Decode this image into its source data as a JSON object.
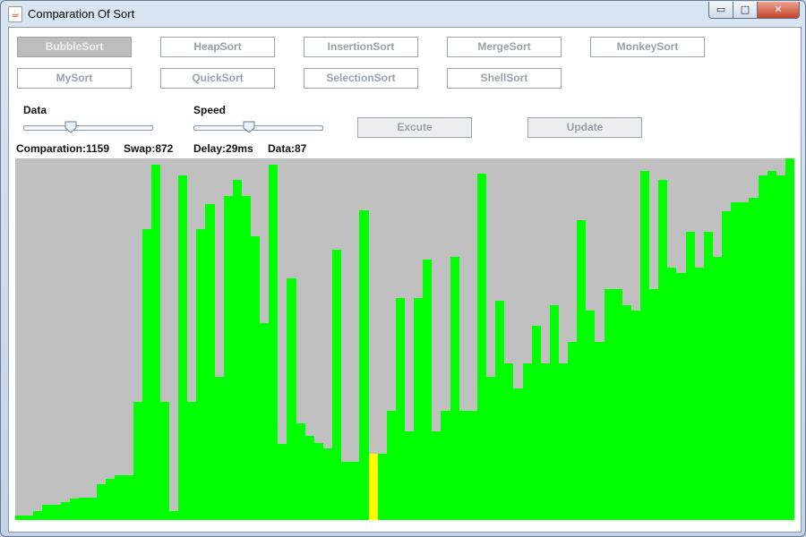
{
  "window": {
    "title": "Comparation Of Sort"
  },
  "window_controls": {
    "minimize": "▭",
    "maximize": "□",
    "close": "✕"
  },
  "sort_buttons": [
    {
      "label": "BubbleSort",
      "active": true
    },
    {
      "label": "HeapSort"
    },
    {
      "label": "InsertionSort"
    },
    {
      "label": "MergeSort"
    },
    {
      "label": "MonkeySort"
    },
    {
      "label": "MySort"
    },
    {
      "label": "QuickSort"
    },
    {
      "label": "SelectionSort"
    },
    {
      "label": "ShellSort"
    }
  ],
  "controls": {
    "data_label": "Data",
    "speed_label": "Speed",
    "execute_label": "Excute",
    "update_label": "Update"
  },
  "sliders": {
    "data_fraction": 0.36,
    "speed_fraction": 0.43
  },
  "stats": {
    "comparation": "Comparation:1159",
    "swap": "Swap:872",
    "delay": "Delay:29ms",
    "data": "Data:87"
  },
  "colors": {
    "bar": "#00ff00",
    "highlight": "#ffff00",
    "background": "#c0c0c0"
  },
  "chart_data": {
    "type": "bar",
    "max": 404,
    "highlight_index": 39,
    "values": [
      5,
      5,
      10,
      17,
      17,
      20,
      24,
      25,
      25,
      40,
      46,
      50,
      50,
      132,
      325,
      397,
      132,
      10,
      385,
      132,
      325,
      353,
      160,
      362,
      380,
      362,
      317,
      220,
      397,
      85,
      270,
      108,
      94,
      86,
      80,
      302,
      65,
      65,
      346,
      74,
      74,
      122,
      248,
      99,
      248,
      291,
      99,
      122,
      294,
      122,
      122,
      387,
      160,
      245,
      175,
      147,
      175,
      217,
      175,
      240,
      175,
      199,
      335,
      234,
      199,
      258,
      258,
      240,
      234,
      390,
      258,
      380,
      282,
      276,
      322,
      282,
      322,
      294,
      345,
      355,
      355,
      360,
      385,
      390,
      385,
      404
    ]
  }
}
